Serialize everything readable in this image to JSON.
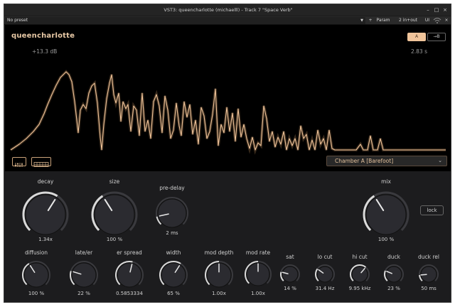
{
  "window": {
    "title": "VST3: queencharlotte (michaelll) - Track 7 \"Space Verb\"",
    "min_glyph": "–",
    "max_glyph": "□",
    "close_glyph": "×"
  },
  "toolbar": {
    "preset": "No preset",
    "preset_caret": "▼",
    "add_label": "+",
    "param_label": "Param",
    "io_label": "2 in+out",
    "ui_label": "UI"
  },
  "plugin": {
    "name": "queencharlotte",
    "name_caret": "⌄",
    "db_readout": "+13.3 dB",
    "time_readout": "2.83 s",
    "ab_a": "A",
    "ab_b": "→B",
    "mode": "Chamber A [Barefoot]",
    "mode_arrow": "⌄",
    "lock_label": "lock",
    "accent_color": "#f0c49a"
  },
  "knobs": [
    {
      "id": "decay",
      "label": "decay",
      "value": "1.34x",
      "level": 0.62
    },
    {
      "id": "size",
      "label": "size",
      "value": "100 %",
      "level": 0.38
    },
    {
      "id": "pre-delay",
      "label": "pre-delay",
      "value": "2 ms",
      "level": 0.12
    },
    {
      "id": "mix",
      "label": "mix",
      "value": "100 %",
      "level": 0.38
    },
    {
      "id": "diffusion",
      "label": "diffusion",
      "value": "100 %",
      "level": 0.38
    },
    {
      "id": "late-er",
      "label": "late/er",
      "value": "22 %",
      "level": 0.23
    },
    {
      "id": "er-spread",
      "label": "er spread",
      "value": "0.5853334",
      "level": 0.55
    },
    {
      "id": "width",
      "label": "width",
      "value": "65 %",
      "level": 0.62
    },
    {
      "id": "mod-depth",
      "label": "mod depth",
      "value": "1.00x",
      "level": 0.5
    },
    {
      "id": "mod-rate",
      "label": "mod rate",
      "value": "1.00x",
      "level": 0.5
    },
    {
      "id": "sat",
      "label": "sat",
      "value": "14 %",
      "level": 0.22
    },
    {
      "id": "lo-cut",
      "label": "lo cut",
      "value": "31.4 Hz",
      "level": 0.3
    },
    {
      "id": "hi-cut",
      "label": "hi cut",
      "value": "9.95 kHz",
      "level": 0.65
    },
    {
      "id": "duck",
      "label": "duck",
      "value": "23 %",
      "level": 0.25
    },
    {
      "id": "duck-rel",
      "label": "duck rel",
      "value": "50 ms",
      "level": 0.15
    }
  ]
}
